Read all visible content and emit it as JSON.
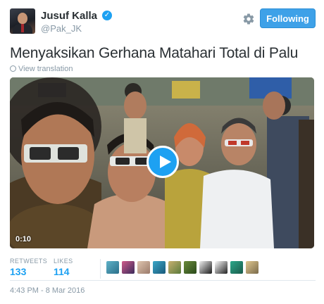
{
  "author": {
    "name": "Jusuf Kalla",
    "handle": "@Pak_JK",
    "verified_mark": "✓"
  },
  "actions": {
    "follow_label": "Following"
  },
  "tweet": {
    "text": "Menyaksikan Gerhana Matahari Total di Palu",
    "translate_label": "View translation"
  },
  "media": {
    "duration": "0:10"
  },
  "stats": {
    "retweets_label": "RETWEETS",
    "retweets_count": "133",
    "likes_label": "LIKES",
    "likes_count": "114"
  },
  "timestamp": "4:43 PM - 8 Mar 2016",
  "colors": {
    "accent": "#1da1f2",
    "follow_button": "#3ea1e8",
    "muted_text": "#8899a6"
  }
}
